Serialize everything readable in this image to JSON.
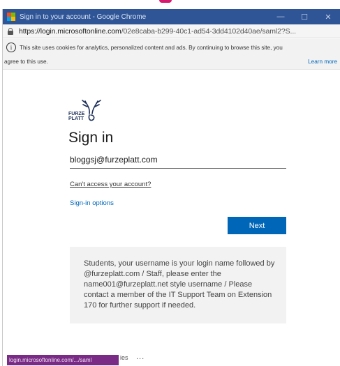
{
  "window": {
    "title": "Sign in to your account - Google Chrome",
    "url_host": "https://login.microsoftonline.com",
    "url_path": "/02e8caba-b299-40c1-ad54-3dd4102d40ae/saml2?S..."
  },
  "cookie_banner": {
    "message_line1": "This site uses cookies for analytics, personalized content and ads. By continuing to browse this site, you",
    "message_line2": "agree to this use.",
    "learn_more": "Learn more"
  },
  "signin": {
    "logo_text_top": "FURZE",
    "logo_text_bottom": "PLATT",
    "heading": "Sign in",
    "email_value": "bloggsj@furzeplatt.com",
    "cant_access": "Can't access your account?",
    "signin_options": "Sign-in options",
    "next_label": "Next",
    "notice": "Students, your username is your login name followed by @furzeplatt.com / Staff, please enter the name001@furzeplatt.net style username / Please contact a member of the IT Support Team on Extension 170 for further support if needed."
  },
  "statusbar": {
    "tooltip": "login.microsoftonline.com/.../saml",
    "after_text": "ies",
    "dots": "..."
  },
  "colors": {
    "titlebar": "#2f5597",
    "accent": "#0067b8",
    "notice_bg": "#f2f2f2",
    "status_tip": "#7a2b86"
  },
  "icons": {
    "app": "microsoft-logo-icon",
    "lock": "lock-icon",
    "info": "info-icon",
    "minimize": "minimize-icon",
    "maximize": "maximize-icon",
    "close": "close-icon"
  }
}
